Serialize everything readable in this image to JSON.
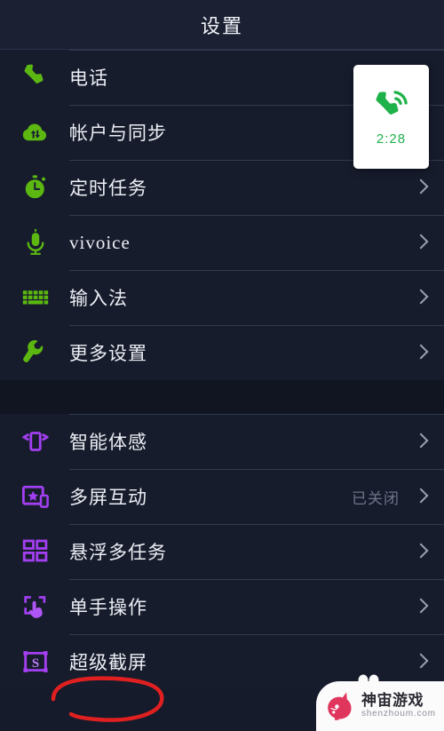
{
  "header": {
    "title": "设置"
  },
  "colors": {
    "background": "#161b2b",
    "header_bg": "#1b2133",
    "group_bg": "#171c2d",
    "gap_bg": "#111522",
    "divider": "#343b4f",
    "label": "#eceef4",
    "value": "#6d7488",
    "chevron": "#9aa0b2",
    "icon_green": "#5cb811",
    "icon_purple": "#a23ff0",
    "annotation_red": "#e02020",
    "card_bg": "#ffffff",
    "call_green": "#22b14c"
  },
  "call_card": {
    "icon": "phone-call-icon",
    "duration": "2:28"
  },
  "groups": [
    {
      "name": "group-primary",
      "rows": [
        {
          "icon": "phone-icon",
          "label": "电话",
          "value": "",
          "chevron": false
        },
        {
          "icon": "cloud-sync-icon",
          "label": "帐户与同步",
          "value": "",
          "chevron": false
        },
        {
          "icon": "stopwatch-icon",
          "label": "定时任务",
          "value": "",
          "chevron": true
        },
        {
          "icon": "microphone-icon",
          "label": "vivoice",
          "value": "",
          "chevron": true
        },
        {
          "icon": "keyboard-icon",
          "label": "输入法",
          "value": "",
          "chevron": true
        },
        {
          "icon": "wrench-icon",
          "label": "更多设置",
          "value": "",
          "chevron": true
        }
      ]
    },
    {
      "name": "group-features",
      "rows": [
        {
          "icon": "motion-sense-icon",
          "label": "智能体感",
          "value": "",
          "chevron": true
        },
        {
          "icon": "multiscreen-icon",
          "label": "多屏互动",
          "value": "已关闭",
          "chevron": true
        },
        {
          "icon": "multitask-grid-icon",
          "label": "悬浮多任务",
          "value": "",
          "chevron": true
        },
        {
          "icon": "one-hand-icon",
          "label": "单手操作",
          "value": "",
          "chevron": true
        },
        {
          "icon": "super-screenshot-icon",
          "label": "超级截屏",
          "value": "",
          "chevron": true
        }
      ]
    }
  ],
  "annotation": {
    "name": "red-circle-annotation",
    "target": "超级截屏"
  },
  "watermark": {
    "logo": "unicorn-logo",
    "title": "神宙游戏",
    "subtitle": "shenzhoum.com"
  }
}
